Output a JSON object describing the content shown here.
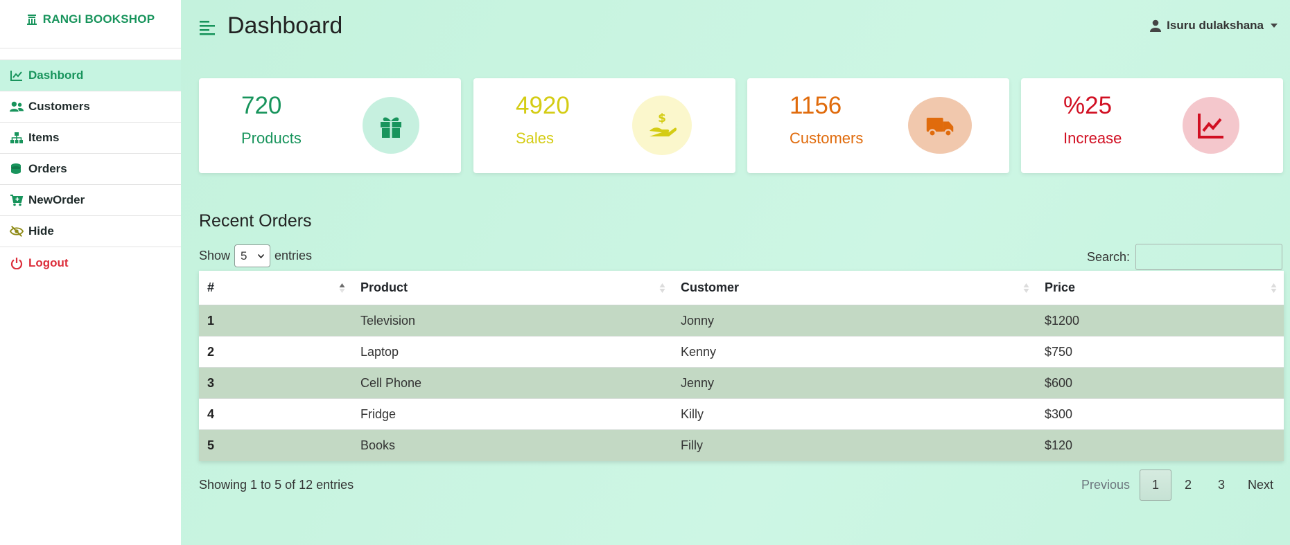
{
  "brand": {
    "name": "RANGI BOOKSHOP",
    "icon": "bookshop-icon"
  },
  "sidebar": {
    "items": [
      {
        "label": "Dashbord",
        "icon": "chart-line-icon"
      },
      {
        "label": "Customers",
        "icon": "users-icon"
      },
      {
        "label": "Items",
        "icon": "sitemap-icon"
      },
      {
        "label": "Orders",
        "icon": "coins-icon"
      },
      {
        "label": "NewOrder",
        "icon": "cart-plus-icon"
      },
      {
        "label": "Hide",
        "icon": "eye-slash-icon"
      },
      {
        "label": "Logout",
        "icon": "power-icon"
      }
    ]
  },
  "header": {
    "title": "Dashboard",
    "user": "Isuru dulakshana"
  },
  "cards": [
    {
      "value": "720",
      "label": "Products",
      "color": "#18945c",
      "bg": "#c6f0df",
      "icon": "gift-icon"
    },
    {
      "value": "4920",
      "label": "Sales",
      "color": "#d4cc14",
      "bg": "#fbf7cc",
      "icon": "hand-dollar-icon"
    },
    {
      "value": "1156",
      "label": "Customers",
      "color": "#e06b0c",
      "bg": "#f1c8ad",
      "icon": "truck-icon"
    },
    {
      "value": "%25",
      "label": "Increase",
      "color": "#d10f22",
      "bg": "#f4c7cc",
      "icon": "chart-up-icon"
    }
  ],
  "orders": {
    "title": "Recent Orders",
    "show_label": "Show",
    "entries_label": "entries",
    "page_size": "5",
    "search_label": "Search:",
    "search_value": "",
    "columns": [
      "#",
      "Product",
      "Customer",
      "Price"
    ],
    "rows": [
      [
        "1",
        "Television",
        "Jonny",
        "$1200"
      ],
      [
        "2",
        "Laptop",
        "Kenny",
        "$750"
      ],
      [
        "3",
        "Cell Phone",
        "Jenny",
        "$600"
      ],
      [
        "4",
        "Fridge",
        "Killy",
        "$300"
      ],
      [
        "5",
        "Books",
        "Filly",
        "$120"
      ]
    ],
    "info": "Showing 1 to 5 of 12 entries",
    "pagination": {
      "previous": "Previous",
      "pages": [
        "1",
        "2",
        "3"
      ],
      "current": "1",
      "next": "Next"
    }
  }
}
